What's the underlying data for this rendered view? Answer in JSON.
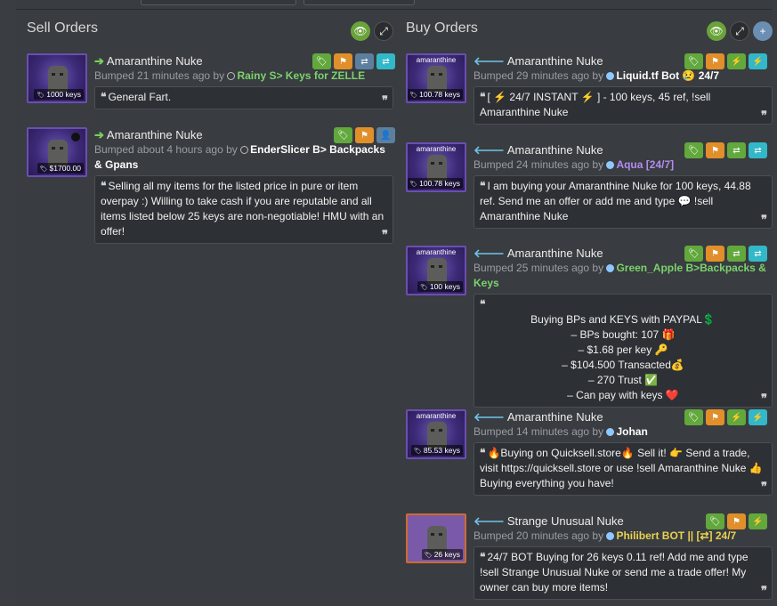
{
  "sell": {
    "title": "Sell Orders",
    "listings": [
      {
        "item": "Amaranthine Nuke",
        "price": "1000 keys",
        "bumped": "Bumped 21 minutes ago by",
        "user": "Rainy S> Keys for ZELLE",
        "message": "General Fart."
      },
      {
        "item": "Amaranthine Nuke",
        "price": "$1700.00",
        "bumped": "Bumped about 4 hours ago by",
        "user": "EnderSlicer B> Backpacks & Gpans",
        "message": "Selling all my items for the listed price in pure or item overpay :) Willing to take cash if you are reputable and all items listed below 25 keys are non-negotiable! HMU with an offer!"
      }
    ]
  },
  "buy": {
    "title": "Buy Orders",
    "listings": [
      {
        "item": "Amaranthine Nuke",
        "thumb_label": "amaranthine",
        "price": "100.78 keys",
        "bumped": "Bumped 29 minutes ago by",
        "user": "Liquid.tf Bot 😢 24/7",
        "message": "[ ⚡ 24/7 INSTANT ⚡ ] - 100 keys, 45 ref, !sell Amaranthine Nuke"
      },
      {
        "item": "Amaranthine Nuke",
        "thumb_label": "amaranthine",
        "price": "100.78 keys",
        "bumped": "Bumped 24 minutes ago by",
        "user": "Aqua [24/7]",
        "message": "I am buying your Amaranthine Nuke for 100 keys, 44.88 ref. Send me an offer or add me and type 💬 !sell Amaranthine Nuke"
      },
      {
        "item": "Amaranthine Nuke",
        "thumb_label": "amaranthine",
        "price": "100 keys",
        "bumped": "Bumped 25 minutes ago by",
        "user": "Green_Apple B>Backpacks & Keys",
        "lines": [
          "Buying BPs and KEYS with PAYPAL💲",
          "– BPs bought: 107 🎁",
          "– $1.68 per key 🔑",
          "– $104.500 Transacted💰",
          "– 270 Trust ✅",
          "– Can pay with keys ❤️"
        ]
      },
      {
        "item": "Amaranthine Nuke",
        "thumb_label": "amaranthine",
        "price": "85.53 keys",
        "bumped": "Bumped 14 minutes ago by",
        "user": "Johan",
        "message": "🔥Buying on Quicksell.store🔥 Sell it! 👉 Send a trade, visit https://quicksell.store or use !sell Amaranthine Nuke 👍 Buying everything you have!"
      },
      {
        "item": "Strange Unusual Nuke",
        "price": "26 keys",
        "bumped": "Bumped 20 minutes ago by",
        "user": "Philibert BOT || [⇄] 24/7",
        "message": "24/7 BOT Buying for 26 keys 0.11 ref! Add me and type !sell Strange Unusual Nuke or send me a trade offer! My owner can buy more items!"
      }
    ]
  },
  "colors": {
    "green": "#62a83d",
    "orange": "#e08f2a",
    "cyan": "#32b8c8"
  }
}
